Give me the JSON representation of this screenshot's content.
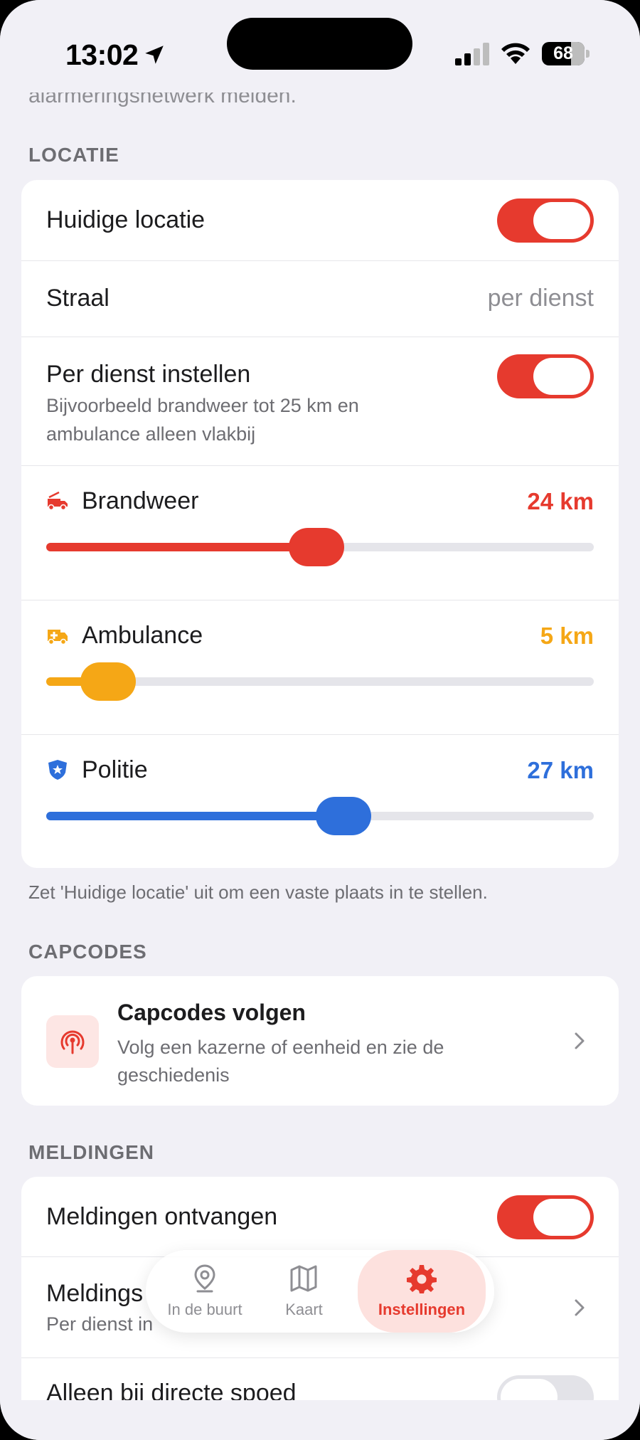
{
  "status_bar": {
    "time": "13:02",
    "battery": "68",
    "battery_level": 0.68
  },
  "scrolled_text": "alarmeringsnetwerk melden.",
  "colors": {
    "accent_red": "#e63a2e",
    "ambulance": "#f5a716",
    "police": "#2e6fdb",
    "track": "#e5e5ea"
  },
  "locatie": {
    "header": "LOCATIE",
    "huidige_locatie": {
      "label": "Huidige locatie",
      "on": true
    },
    "straal": {
      "label": "Straal",
      "value": "per dienst"
    },
    "per_dienst": {
      "label": "Per dienst instellen",
      "sub1": "Bijvoorbeeld brandweer tot 25 km en",
      "sub2": "ambulance alleen vlakbij",
      "on": true
    },
    "services": [
      {
        "name": "Brandweer",
        "icon": "fire-truck-icon",
        "value": "24 km",
        "km": 24,
        "color": "#e63a2e",
        "fraction": 0.48
      },
      {
        "name": "Ambulance",
        "icon": "ambulance-icon",
        "value": "5 km",
        "km": 5,
        "color": "#f5a716",
        "fraction": 0.1
      },
      {
        "name": "Politie",
        "icon": "police-badge-icon",
        "value": "27 km",
        "km": 27,
        "color": "#2e6fdb",
        "fraction": 0.53
      }
    ],
    "footnote": "Zet 'Huidige locatie' uit om een vaste plaats in te stellen."
  },
  "capcodes": {
    "header": "CAPCODES",
    "title": "Capcodes volgen",
    "sub1": "Volg een kazerne of eenheid en zie de",
    "sub2": "geschiedenis",
    "icon": "antenna-icon"
  },
  "meldingen": {
    "header": "MELDINGEN",
    "ontvangen": {
      "label": "Meldingen ontvangen",
      "on": true
    },
    "meldings": {
      "label": "Meldings",
      "sub": "Per dienst in"
    },
    "spoed": {
      "label": "Alleen bij directe spoed",
      "on": false
    }
  },
  "tabbar": {
    "tabs": [
      {
        "label": "In de buurt",
        "icon": "location-pin-icon"
      },
      {
        "label": "Kaart",
        "icon": "map-icon"
      },
      {
        "label": "Instellingen",
        "icon": "gear-icon",
        "active": true
      }
    ]
  }
}
